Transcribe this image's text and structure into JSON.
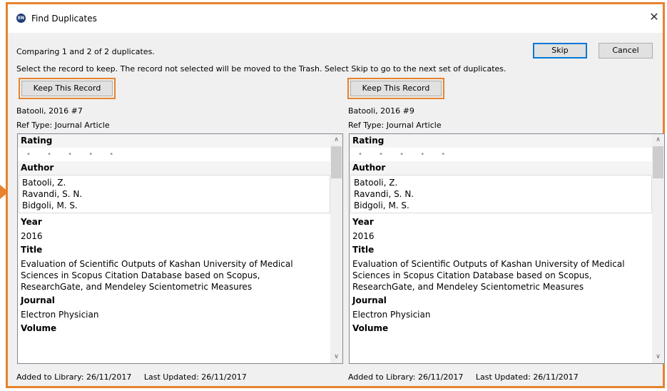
{
  "window": {
    "title": "Find Duplicates",
    "icon_label": "EN"
  },
  "status": {
    "comparing": "Comparing 1 and 2 of 2 duplicates.",
    "instructions": "Select the record to keep. The record not selected will be moved to the Trash. Select Skip to go to the next set of duplicates."
  },
  "buttons": {
    "skip": "Skip",
    "cancel": "Cancel",
    "keep": "Keep This Record"
  },
  "accent_color": "#e8822d",
  "records": [
    {
      "name": "Batooli, 2016 #7",
      "ref_type": "Ref Type: Journal Article",
      "rating_label": "Rating",
      "rating_dots": "• • • • •",
      "author_label": "Author",
      "authors": [
        "Batooli, Z.",
        "Ravandi, S. N.",
        "Bidgoli, M. S."
      ],
      "year_label": "Year",
      "year": "2016",
      "title_label": "Title",
      "title_lines": [
        "Evaluation of Scientific Outputs of Kashan University of Medical",
        "Sciences in Scopus Citation Database based on Scopus,",
        "ResearchGate, and Mendeley Scientometric Measures"
      ],
      "journal_label": "Journal",
      "journal": "Electron Physician",
      "volume_label": "Volume",
      "added": "Added to Library: 26/11/2017",
      "updated": "Last Updated: 26/11/2017"
    },
    {
      "name": "Batooli, 2016 #9",
      "ref_type": "Ref Type: Journal Article",
      "rating_label": "Rating",
      "rating_dots": "• • • • •",
      "author_label": "Author",
      "authors": [
        "Batooli, Z.",
        "Ravandi, S. N.",
        "Bidgoli, M. S."
      ],
      "year_label": "Year",
      "year": "2016",
      "title_label": "Title",
      "title_lines": [
        "Evaluation of Scientific Outputs of Kashan University of Medical",
        "Sciences in Scopus Citation Database based on Scopus,",
        "ResearchGate, and Mendeley Scientometric Measures"
      ],
      "journal_label": "Journal",
      "journal": "Electron Physician",
      "volume_label": "Volume",
      "added": "Added to Library: 26/11/2017",
      "updated": "Last Updated: 26/11/2017"
    }
  ]
}
